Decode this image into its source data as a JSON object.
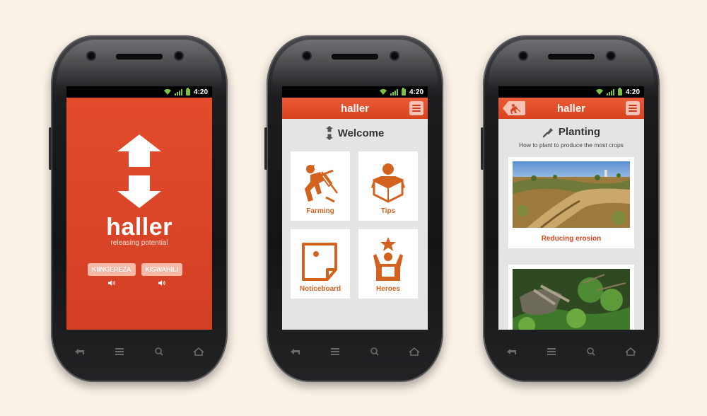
{
  "status": {
    "time": "4:20"
  },
  "colors": {
    "brand": "#d94a2a",
    "accent_orange": "#d4621f",
    "background": "#fbf2e7"
  },
  "screen1": {
    "title": "haller",
    "tagline": "releasing potential",
    "languages": [
      "KIINGEREZA",
      "KISWAHILI"
    ]
  },
  "screen2": {
    "app_title": "haller",
    "heading": "Welcome",
    "tiles": [
      {
        "label": "Farming",
        "icon": "farmer-icon"
      },
      {
        "label": "Tips",
        "icon": "reading-person-icon"
      },
      {
        "label": "Noticeboard",
        "icon": "note-icon"
      },
      {
        "label": "Heroes",
        "icon": "hero-star-icon"
      }
    ]
  },
  "screen3": {
    "app_title": "haller",
    "heading": "Planting",
    "subtitle": "How to plant to produce the most crops",
    "cards": [
      {
        "label": "Reducing erosion"
      }
    ]
  }
}
